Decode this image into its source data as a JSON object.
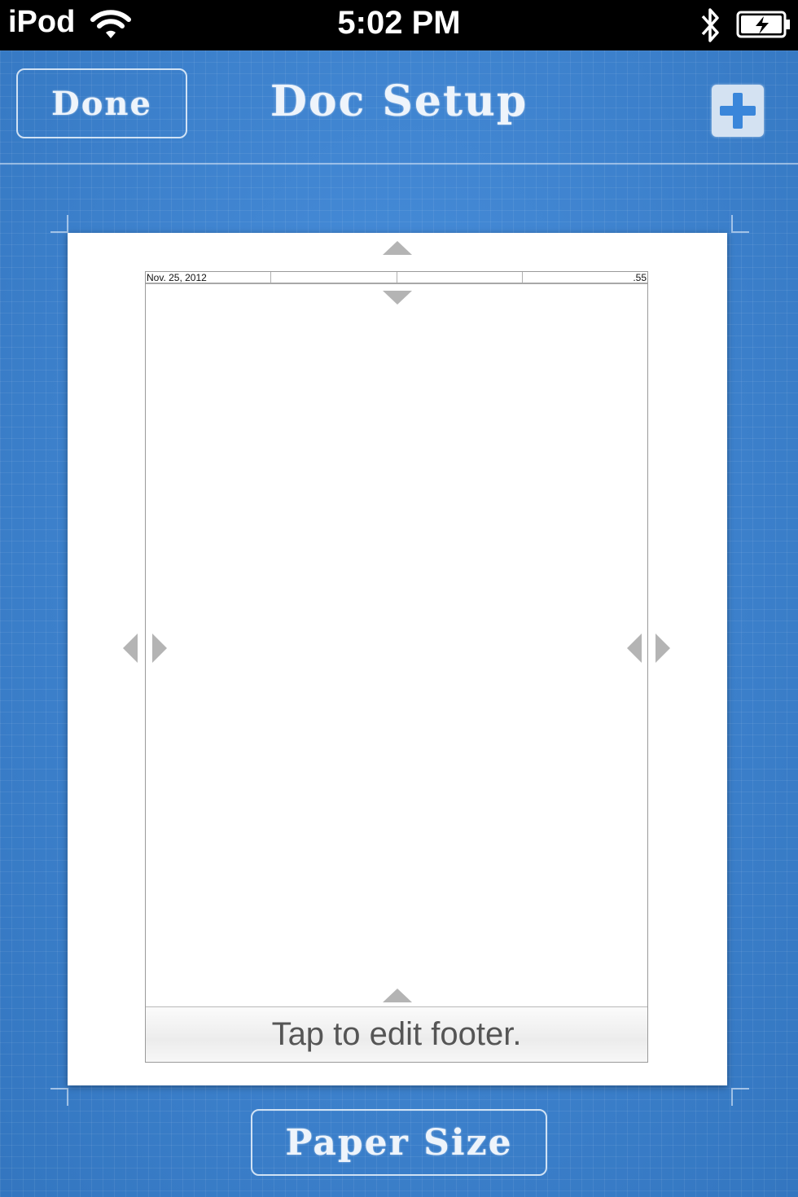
{
  "status_bar": {
    "carrier": "iPod",
    "time": "5:02 PM",
    "icons": [
      "wifi-icon",
      "bluetooth-icon",
      "battery-charging-icon"
    ]
  },
  "nav": {
    "done_label": "Done",
    "title": "Doc Setup",
    "add_icon": "plus-icon"
  },
  "page": {
    "header_cells": [
      "Nov. 25, 2012",
      "",
      "",
      ".55"
    ],
    "footer_label": "Tap to edit footer."
  },
  "bottom": {
    "paper_size_label": "Paper Size"
  },
  "colors": {
    "blueprint": "#3a86da",
    "chalk": "#eef4fb",
    "arrow": "#b4b4b4"
  }
}
